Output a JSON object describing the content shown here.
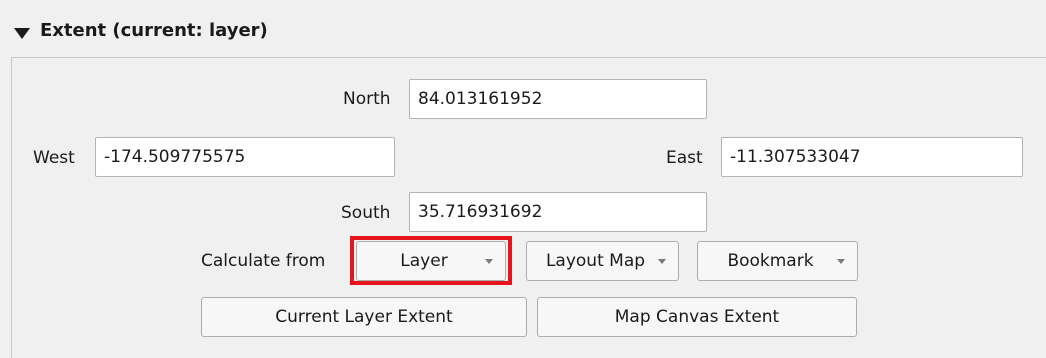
{
  "section": {
    "title": "Extent (current: layer)"
  },
  "fields": {
    "north": {
      "label": "North",
      "value": "84.013161952"
    },
    "west": {
      "label": "West",
      "value": "-174.509775575"
    },
    "east": {
      "label": "East",
      "value": "-11.307533047"
    },
    "south": {
      "label": "South",
      "value": "35.716931692"
    }
  },
  "calculate": {
    "label": "Calculate from",
    "layer_combo": "Layer",
    "layout_map_combo": "Layout Map",
    "bookmark_combo": "Bookmark"
  },
  "buttons": {
    "current_layer_extent": "Current Layer Extent",
    "map_canvas_extent": "Map Canvas Extent"
  },
  "colors": {
    "highlight": "#e8141c"
  }
}
